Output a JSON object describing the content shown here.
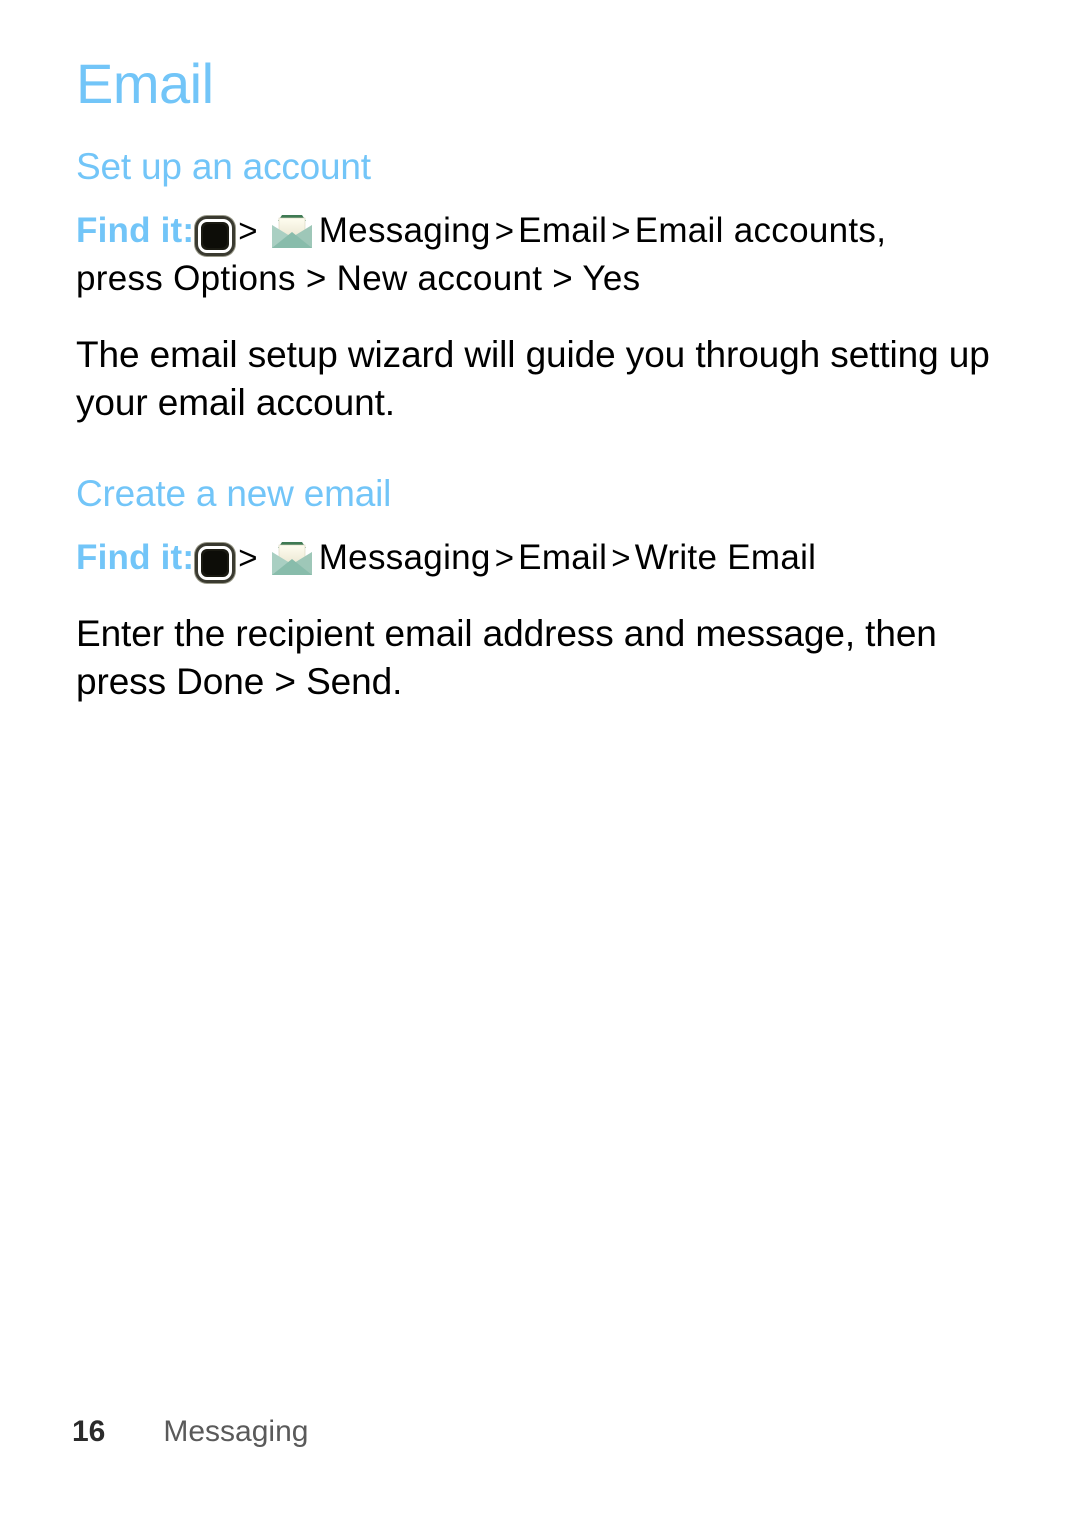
{
  "page": {
    "title": "Email",
    "background_color": "#ffffff",
    "heading_color": "#72C5F8",
    "body_color": "#000000"
  },
  "sections": [
    {
      "heading": "Set up an account",
      "findit": {
        "label": "Find it:",
        "icons": [
          "center-key-icon",
          "envelope-icon"
        ],
        "separator": ">",
        "path_segment_1": "Messaging",
        "path_segment_2": "Email",
        "path_segment_3": "Email accounts,",
        "continuation": "press Options > New account > Yes"
      },
      "body": "The email setup wizard will guide you through setting up your email account."
    },
    {
      "heading": "Create a new email",
      "findit": {
        "label": "Find it:",
        "icons": [
          "center-key-icon",
          "envelope-icon"
        ],
        "separator": ">",
        "path_segment_1": "Messaging",
        "path_segment_2": "Email",
        "path_segment_3": "Write Email",
        "continuation": ""
      },
      "body": "Enter the recipient email address and message, then press Done > Send."
    }
  ],
  "footer": {
    "page_number": "16",
    "section_name": "Messaging"
  },
  "icons": {
    "center_key": {
      "name": "center-key-icon",
      "center_color": "#0d0d08",
      "ring_color": "#ffffff",
      "border_color": "#3a3a30"
    },
    "envelope": {
      "name": "envelope-icon",
      "body_color": "#a9cfc2",
      "letter_color": "#f5f2e2",
      "flap_color": "#4e8c62"
    }
  }
}
